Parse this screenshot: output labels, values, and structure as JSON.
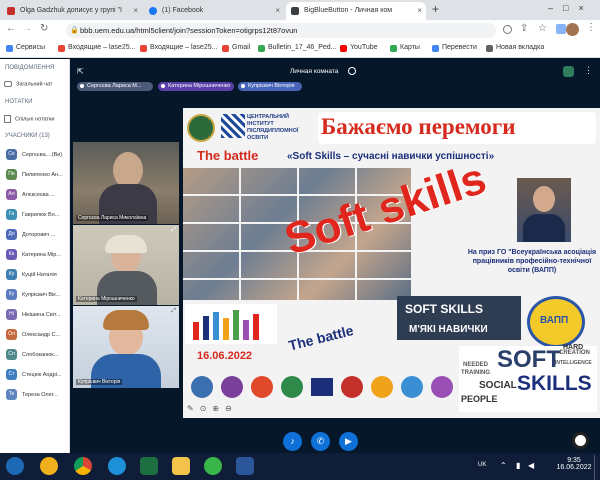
{
  "browser": {
    "tabs": [
      {
        "title": "Olga Gadzhuk дописує у групі \"I",
        "icon_color": "#c4302b"
      },
      {
        "title": "(1) Facebook",
        "icon_color": "#1877f2"
      },
      {
        "title": "BigBlueButton - Личная ком",
        "icon_color": "#3c4043"
      }
    ],
    "new_tab": "+",
    "url": "bbb.uem.edu.ua/html5client/join?sessionToken=otigrps12t87ovun",
    "bookmarks": [
      {
        "label": "Сервисы",
        "color": "#4285f4"
      },
      {
        "label": "Входящие – lase25...",
        "color": "#ea4335"
      },
      {
        "label": "Входящие – lase25...",
        "color": "#ea4335"
      },
      {
        "label": "Gmail",
        "color": "#ea4335"
      },
      {
        "label": "Bulletin_17_46_Ped...",
        "color": "#34a853"
      },
      {
        "label": "YouTube",
        "color": "#ff0000"
      },
      {
        "label": "Карты",
        "color": "#34a853"
      },
      {
        "label": "Перевести",
        "color": "#4285f4"
      },
      {
        "label": "Новая вкладка",
        "color": "#5f6368"
      }
    ]
  },
  "sidebar": {
    "messages_heading": "ПОВІДОМЛЕННЯ",
    "public_chat": "Загальний чат",
    "notes_heading": "НОТАТКИ",
    "shared_notes": "Спільні нотатки",
    "participants_heading": "УЧАСНИКИ (13)",
    "users": [
      {
        "initials": "Се",
        "name": "Сергєєва....(Ви)",
        "color": "#4a6fa5"
      },
      {
        "initials": "Пи",
        "name": "Пилипенко Ан...",
        "color": "#5c8a4e"
      },
      {
        "initials": "Ал",
        "name": "Алєксеєва ...",
        "color": "#8d5aa6"
      },
      {
        "initials": "Га",
        "name": "Гаврилюк Во...",
        "color": "#3d8fb3"
      },
      {
        "initials": "До",
        "name": "Доторович ...",
        "color": "#4f6bb8"
      },
      {
        "initials": "Ка",
        "name": "Катерина Мір...",
        "color": "#6a5bb5"
      },
      {
        "initials": "Ку",
        "name": "Куцій Наталія",
        "color": "#3f80b0"
      },
      {
        "initials": "Ку",
        "name": "Купрієвич Вік...",
        "color": "#5a7bc0"
      },
      {
        "initials": "Ні",
        "name": "Нікішина Світ...",
        "color": "#7a6ab0"
      },
      {
        "initials": "Ол",
        "name": "Олександр С...",
        "color": "#c5693f"
      },
      {
        "initials": "Сл",
        "name": "Слобоканюк...",
        "color": "#4f8a8b"
      },
      {
        "initials": "Ст",
        "name": "Стецюк Андрі...",
        "color": "#3b7dbd"
      },
      {
        "initials": "Те",
        "name": "Тереза Олег...",
        "color": "#5f86c0"
      }
    ]
  },
  "meeting": {
    "room_title": "Личная комната",
    "talking_chips": [
      "Сергєєва Лариса М...",
      "Катерина Мірошниченко",
      "Купрієвич Вікторія"
    ],
    "videos": [
      {
        "label": "Сергєєва Лариса Миколаївна"
      },
      {
        "label": "Катерина Мірошниченко"
      },
      {
        "label": "Купрієвич Вікторія"
      }
    ]
  },
  "slide": {
    "logo_text": "ЦЕНТРАЛЬНИЙ ІНСТИТУТ ПІСЛЯДИПЛОМНОЇ ОСВІТИ",
    "title": "Бажаємо перемоги",
    "subtitle_left": "The battle",
    "subtitle_right": "«Soft Skills – сучасні навички успішності»",
    "big_text": "Soft skills",
    "battle_text": "The battle",
    "prize_text": "На приз ГО \"Всеукраїнська асоціація працівників професійно-технічної освіти (ВАПП)",
    "banner_1": "SOFT SKILLS",
    "banner_2": "М'ЯКІ НАВИЧКИ",
    "badge": "ВАПП",
    "date": "16.06.2022",
    "cloud_words": [
      "SOFT",
      "SKILLS",
      "SOCIAL",
      "TRAINING",
      "NEEDED",
      "PEOPLE",
      "CREATION",
      "INTELLIGENCE",
      "HARD"
    ]
  },
  "taskbar": {
    "lang": "UK",
    "time": "9:35",
    "date": "16.06.2022"
  }
}
